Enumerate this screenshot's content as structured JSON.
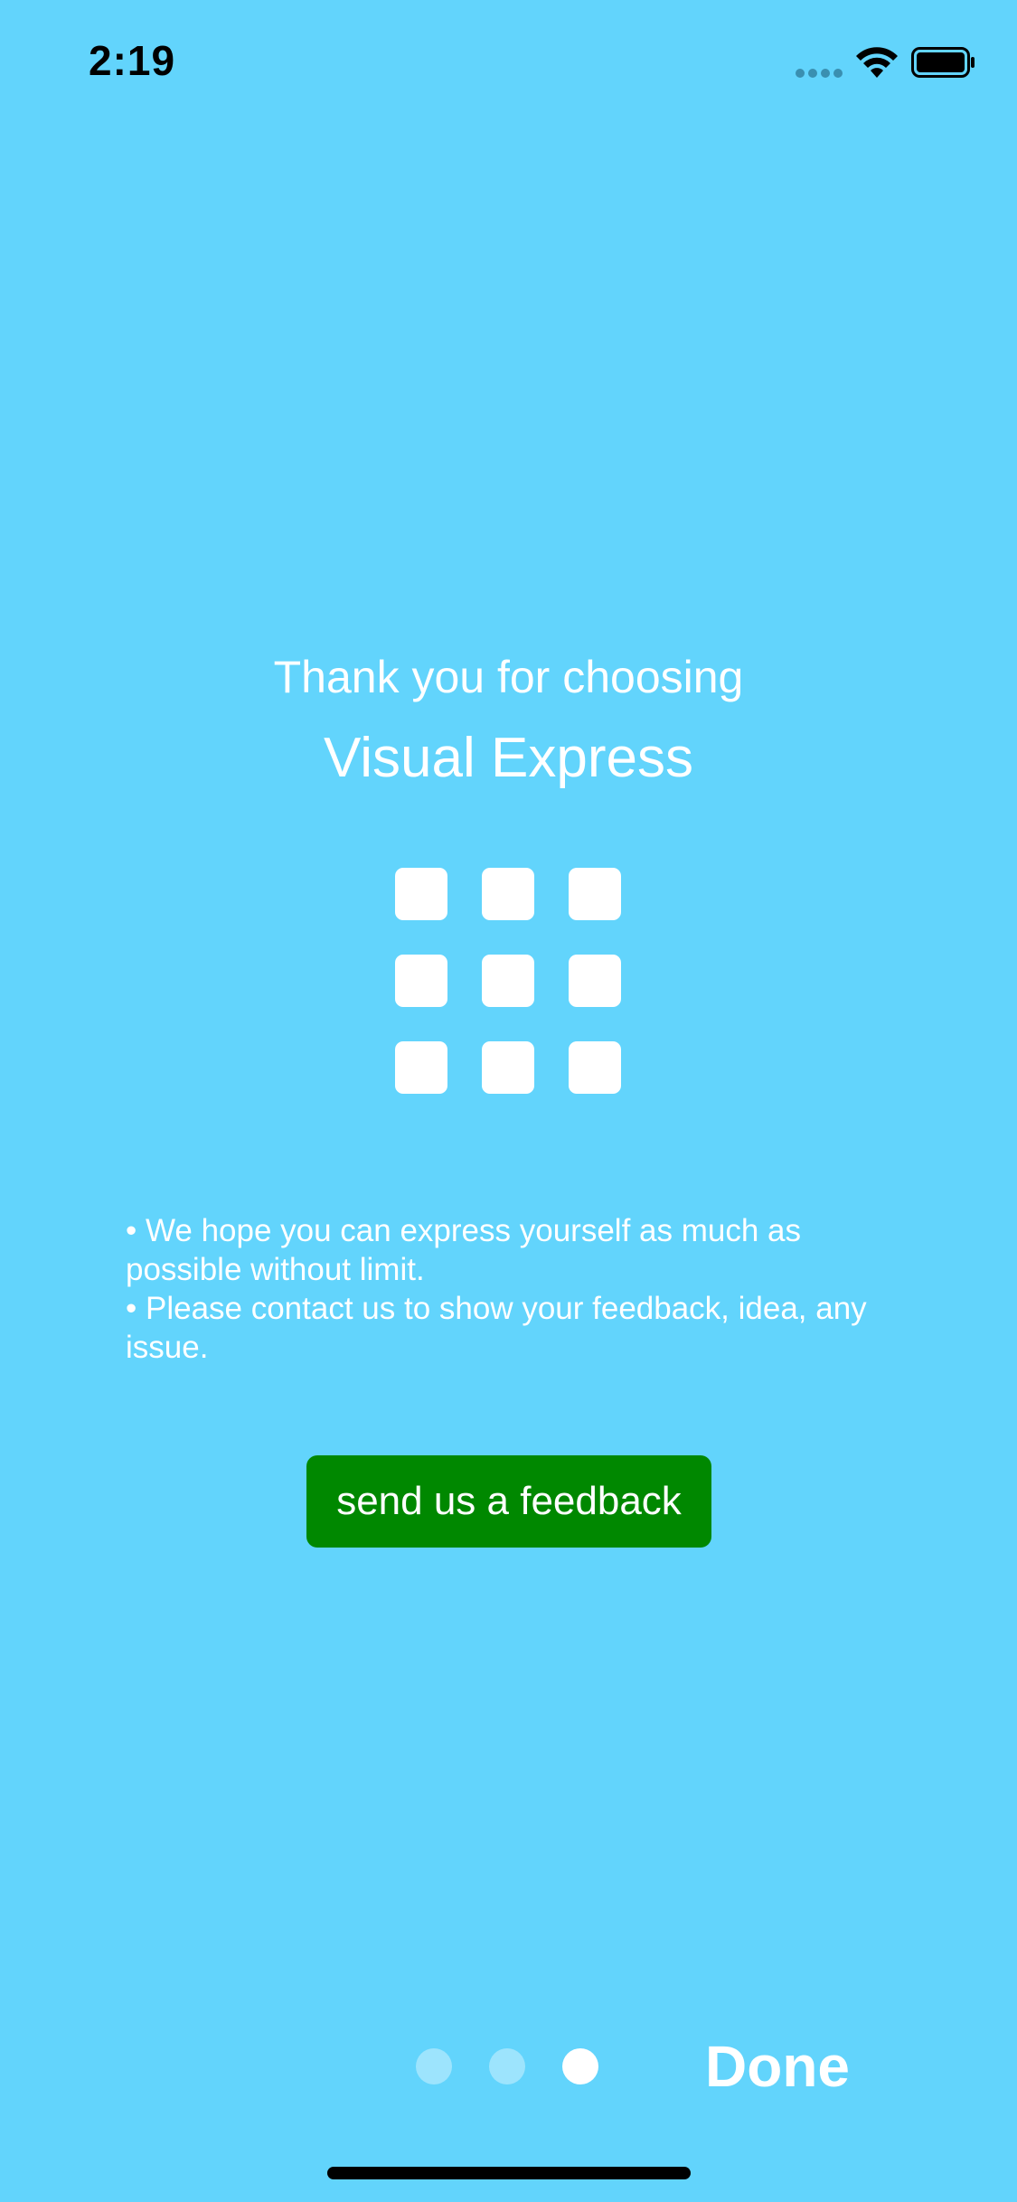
{
  "status_bar": {
    "time": "2:19",
    "icons": [
      "signal-dots-icon",
      "wifi-icon",
      "battery-icon"
    ]
  },
  "main": {
    "title_line1": "Thank you for choosing",
    "title_line2": "Visual Express",
    "logo_icon": "grid-3x3-icon",
    "bullets": [
      " • We hope you can express yourself as much as possible without limit.",
      " • Please contact us to show your feedback, idea, any issue."
    ],
    "feedback_button_label": "send us a feedback"
  },
  "pager": {
    "page_count": 3,
    "current_page": 3
  },
  "done_label": "Done",
  "colors": {
    "background": "#62d4fc",
    "button": "#008800",
    "text": "#ffffff"
  }
}
